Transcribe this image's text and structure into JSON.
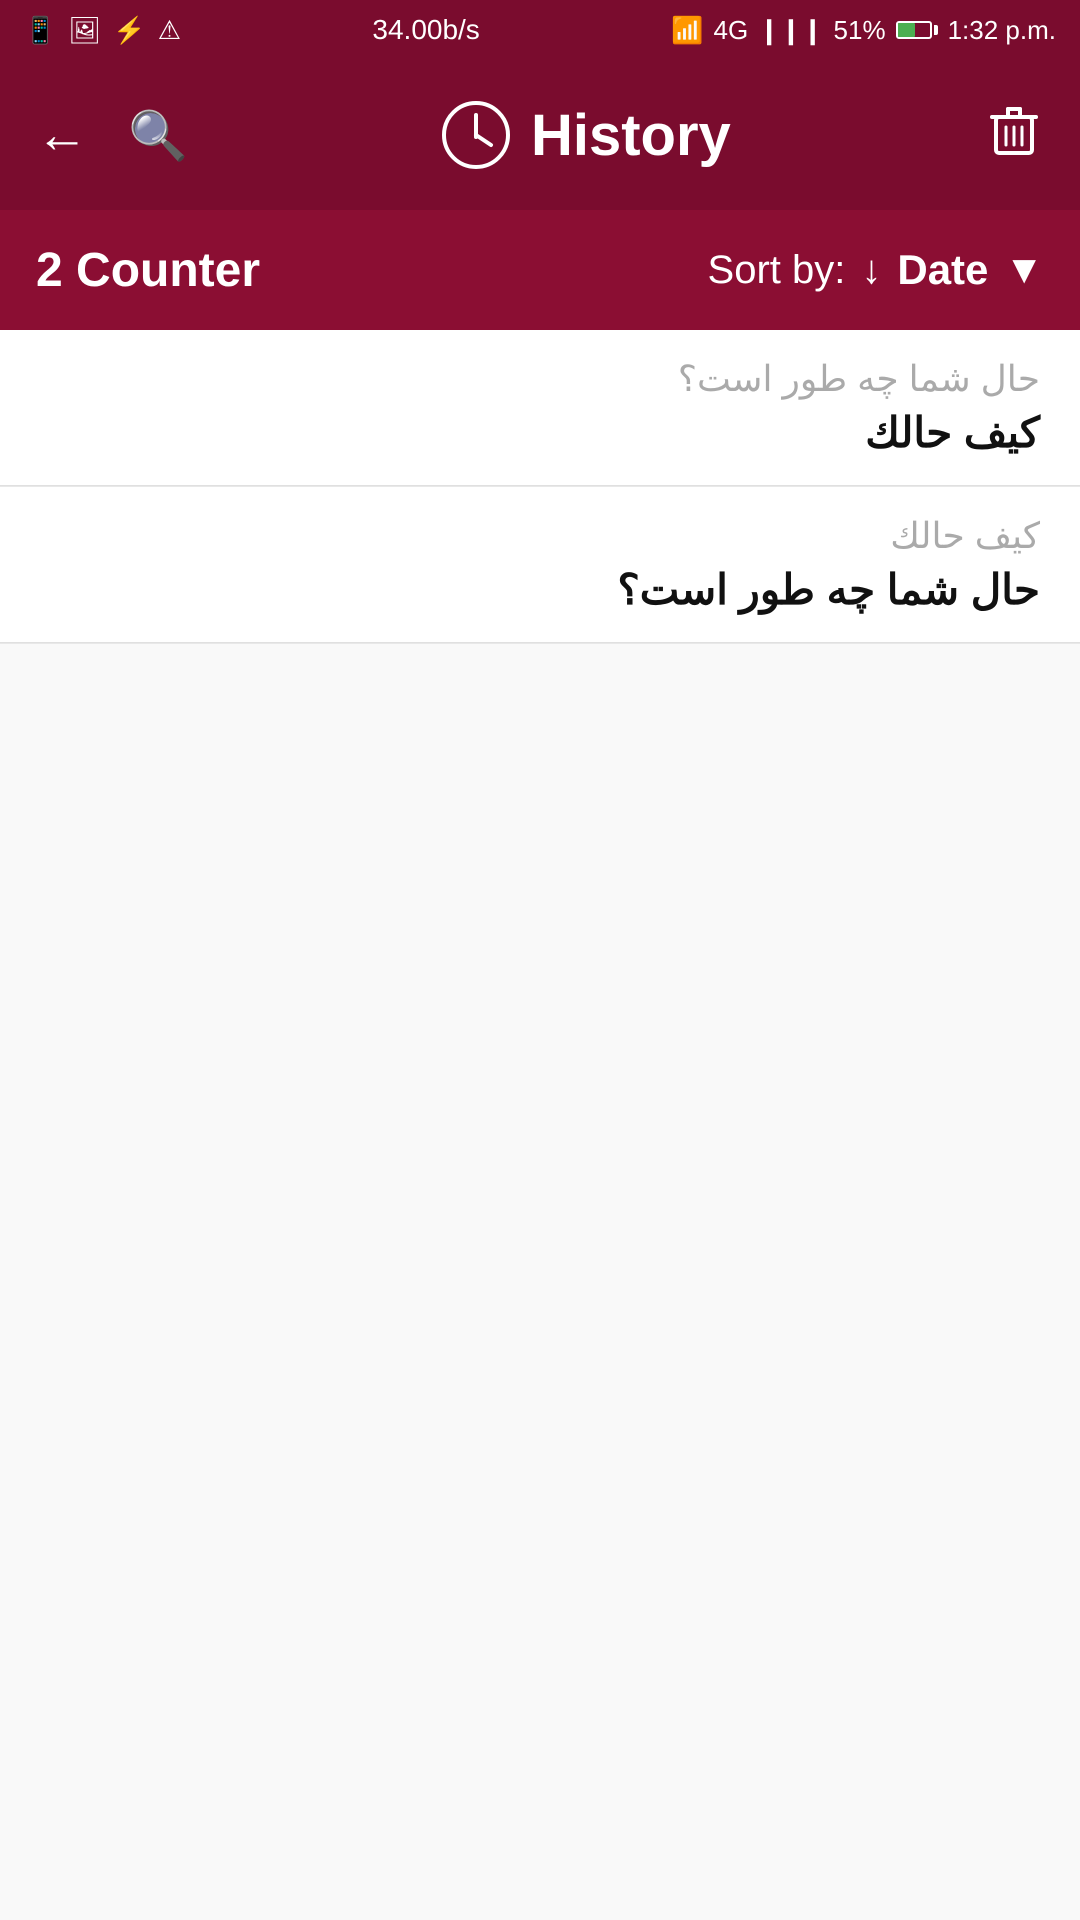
{
  "statusBar": {
    "leftIcons": [
      "whatsapp-icon",
      "image-icon",
      "usb-icon",
      "warning-icon"
    ],
    "network": "34.00b/s",
    "wifi": "wifi-icon",
    "networkType": "4G",
    "signalBars1": "signal-icon",
    "signalBars2": "signal-icon-2",
    "battery": "51%",
    "time": "1:32 p.m."
  },
  "appBar": {
    "title": "History",
    "backLabel": "←",
    "searchLabel": "🔍",
    "trashLabel": "🗑"
  },
  "sortBar": {
    "counterLabel": "2 Counter",
    "sortByLabel": "Sort by:",
    "sortArrow": "↓",
    "dateLabel": "Date",
    "dropdownArrow": "▼"
  },
  "historyItems": [
    {
      "primary": "حال شما چه طور است؟",
      "secondary": "كيف حالك"
    },
    {
      "primary": "كيف حالك",
      "secondary": "حال شما چه طور است؟"
    }
  ],
  "colors": {
    "appBarBg": "#7a0c2e",
    "sortBarBg": "#8b0e33",
    "contentBg": "#f9f9f9"
  }
}
